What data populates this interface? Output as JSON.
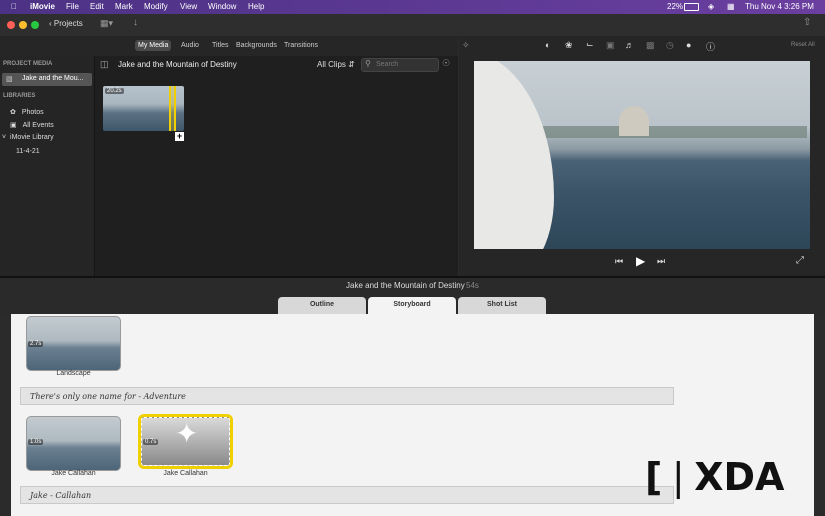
{
  "menubar": {
    "app": "iMovie",
    "items": [
      "File",
      "Edit",
      "Mark",
      "Modify",
      "View",
      "Window",
      "Help"
    ],
    "battery": "22%",
    "datetime": "Thu Nov 4  3:26 PM"
  },
  "toolbar": {
    "projects_label": "Projects"
  },
  "media_tabs": [
    "My Media",
    "Audio",
    "Titles",
    "Backgrounds",
    "Transitions"
  ],
  "sidebar": {
    "project_media_header": "PROJECT MEDIA",
    "project_item": "Jake and the Mou...",
    "libraries_header": "LIBRARIES",
    "photos": "Photos",
    "all_events": "All Events",
    "library": "iMovie Library",
    "event": "11-4-21"
  },
  "browser": {
    "title": "Jake and the Mountain of Destiny",
    "filter": "All Clips",
    "search_placeholder": "Search",
    "clip_duration": "20.2s"
  },
  "viewer": {
    "reset_all": "Reset All"
  },
  "project": {
    "title": "Jake and the Mountain of Destiny",
    "duration": "54s"
  },
  "story_tabs": [
    "Outline",
    "Storyboard",
    "Shot List"
  ],
  "storyboard": {
    "clip1": {
      "duration": "2.7s",
      "caption": "Landscape"
    },
    "title1": "There's only one name for - Adventure",
    "clip2": {
      "duration": "1.0s",
      "caption": "Jake Callahan"
    },
    "clip3": {
      "duration": "0.7s",
      "caption": "Jake Callahan"
    },
    "title2": "Jake - Callahan"
  },
  "watermark": "XDA",
  "colors": {
    "menubar": "#5a3a8a",
    "accent": "#f0d000",
    "selection": "#4a4a4a"
  }
}
